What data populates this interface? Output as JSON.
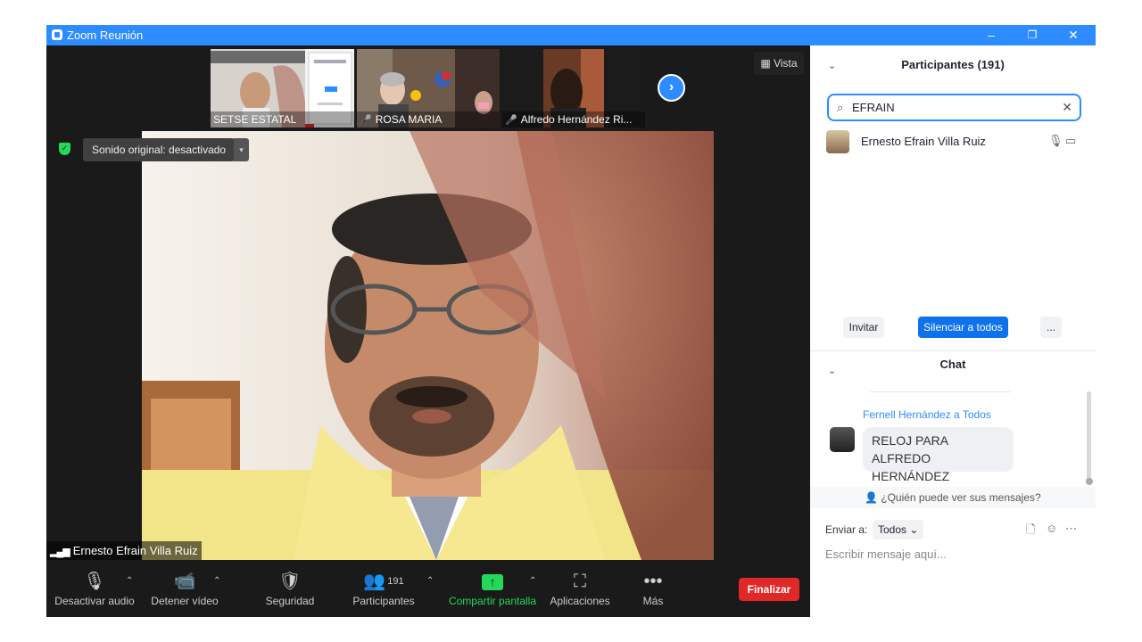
{
  "window": {
    "title": "Zoom Reunión",
    "minimize": "–",
    "restore": "❐",
    "close": "✕"
  },
  "thumbnails": [
    {
      "name": "SETSE ESTATAL",
      "muted": false
    },
    {
      "name": "ROSA MARIA",
      "muted": true
    },
    {
      "name": "Alfredo Hernández Ri...",
      "muted": true
    }
  ],
  "view_button": {
    "icon": "grid-icon",
    "label": "Vista"
  },
  "sound_status": {
    "label": "Sonido original: desactivado",
    "caret": "▾"
  },
  "active_speaker": {
    "name": "Ernesto Efrain Villa Ruiz"
  },
  "toolbar": {
    "audio_label": "Desactivar audio",
    "video_label": "Detener vídeo",
    "security_label": "Seguridad",
    "participants_label": "Participantes",
    "participants_count": "191",
    "share_label": "Compartir pantalla",
    "apps_label": "Aplicaciones",
    "more_label": "Más",
    "end_label": "Finalizar",
    "share_color": "#23d959",
    "end_color": "#e02828"
  },
  "participants_panel": {
    "title": "Participantes (191)",
    "search_value": "EFRAIN",
    "results": [
      {
        "name": "Ernesto Efrain Villa Ruiz"
      }
    ],
    "invite_label": "Invitar",
    "mute_all_label": "Silenciar a todos",
    "more_label": "..."
  },
  "chat": {
    "title": "Chat",
    "messages": [
      {
        "from": "Fernell Hernández a Todos",
        "text": "RELOJ PARA ALFREDO HERNÁNDEZ"
      }
    ],
    "visibility_text": "¿Quién puede ver sus mensajes?",
    "send_to_label": "Enviar a:",
    "send_to_value": "Todos",
    "compose_placeholder": "Escribir mensaje aquí..."
  },
  "colors": {
    "accent": "#2d8cff",
    "toolbar_bg": "#1a1a1a"
  }
}
